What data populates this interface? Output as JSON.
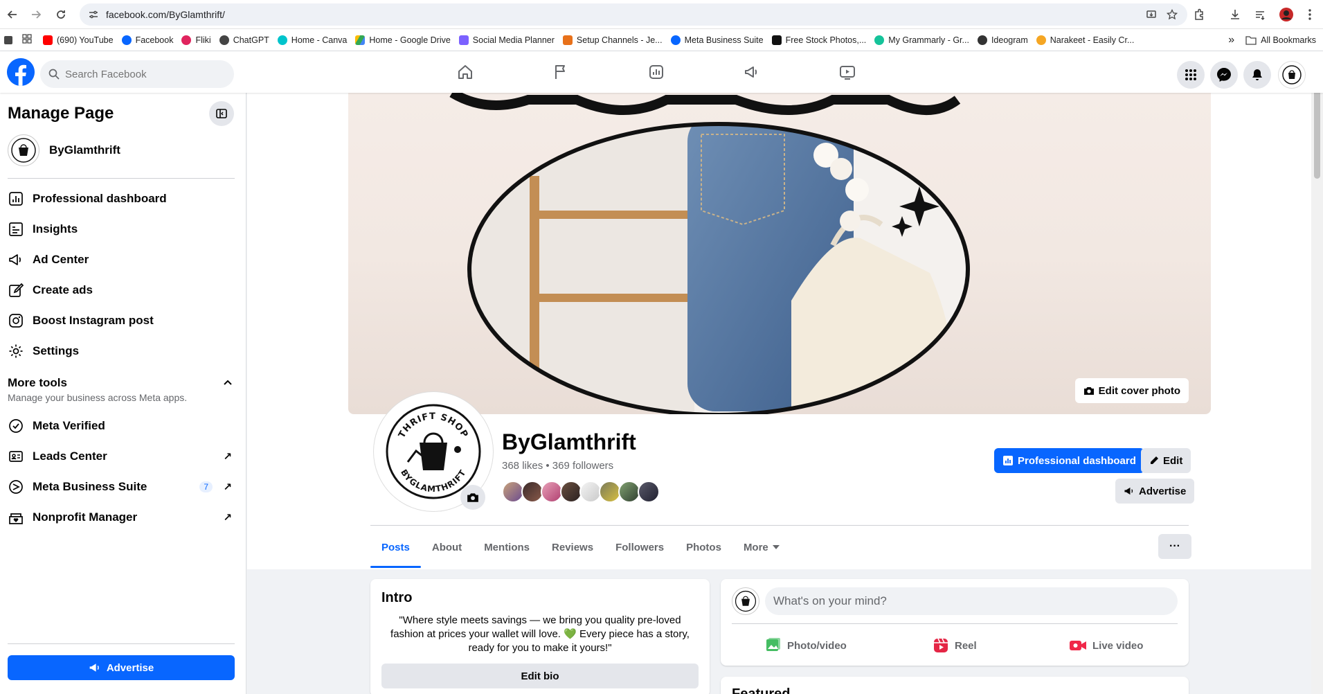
{
  "browser": {
    "url": "facebook.com/ByGlamthrift/",
    "bookmarks": [
      {
        "label": "(690) YouTube",
        "color": "#ff0000"
      },
      {
        "label": "Facebook",
        "color": "#0866ff"
      },
      {
        "label": "Fliki",
        "color": "#e0245e"
      },
      {
        "label": "ChatGPT",
        "color": "#444444"
      },
      {
        "label": "Home - Canva",
        "color": "#00c4cc"
      },
      {
        "label": "Home - Google Drive",
        "color": "#34a853"
      },
      {
        "label": "Social Media Planner",
        "color": "#7b61ff"
      },
      {
        "label": "Setup Channels - Je...",
        "color": "#e8711a"
      },
      {
        "label": "Meta Business Suite",
        "color": "#0866ff"
      },
      {
        "label": "Free Stock Photos,...",
        "color": "#111111"
      },
      {
        "label": "My Grammarly - Gr...",
        "color": "#15c39a"
      },
      {
        "label": "Ideogram",
        "color": "#333333"
      },
      {
        "label": "Narakeet - Easily Cr...",
        "color": "#f5a623"
      }
    ],
    "all_bookmarks": "All Bookmarks",
    "more_bookmarks": "»"
  },
  "fb": {
    "search_placeholder": "Search Facebook",
    "brand_color": "#0866ff"
  },
  "sidebar": {
    "title": "Manage Page",
    "page_name": "ByGlamthrift",
    "items": [
      {
        "label": "Professional dashboard"
      },
      {
        "label": "Insights"
      },
      {
        "label": "Ad Center"
      },
      {
        "label": "Create ads"
      },
      {
        "label": "Boost Instagram post"
      },
      {
        "label": "Settings"
      }
    ],
    "more_tools": {
      "title": "More tools",
      "subtitle": "Manage your business across Meta apps."
    },
    "tools": [
      {
        "label": "Meta Verified"
      },
      {
        "label": "Leads Center",
        "ext": "↗"
      },
      {
        "label": "Meta Business Suite",
        "badge": "7",
        "ext": "↗"
      },
      {
        "label": "Nonprofit Manager",
        "ext": "↗"
      }
    ],
    "advertise": "Advertise"
  },
  "profile": {
    "edit_cover": "Edit cover photo",
    "name": "ByGlamthrift",
    "stats": "368 likes • 369 followers",
    "professional_dashboard": "Professional dashboard",
    "edit": "Edit",
    "advertise": "Advertise",
    "logo_text_top": "THRIFT SHOP",
    "logo_text_bottom": "BYGLAMTHRIFT",
    "tabs": [
      "Posts",
      "About",
      "Mentions",
      "Reviews",
      "Followers",
      "Photos",
      "More"
    ],
    "more_dots": "···"
  },
  "intro": {
    "title": "Intro",
    "bio_line1": "\"Where style meets savings — we bring you quality pre-loved",
    "bio_line2": "fashion at prices your wallet will love. 💚 Every piece has a story,",
    "bio_line3": "ready for you to make it yours!\"",
    "edit_bio": "Edit bio"
  },
  "composer": {
    "placeholder": "What's on your mind?",
    "photo_video": "Photo/video",
    "reel": "Reel",
    "live_video": "Live video"
  },
  "featured": {
    "title": "Featured"
  }
}
